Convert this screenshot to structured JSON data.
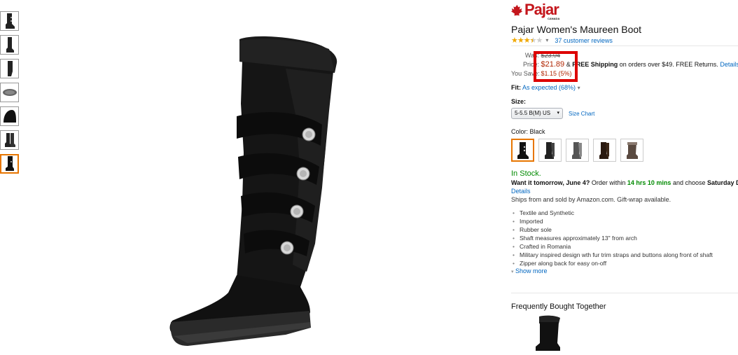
{
  "brand": {
    "name": "Pajar",
    "sub": "CANADA"
  },
  "product": {
    "title": "Pajar Women's Maureen Boot",
    "rating_stars": 3.5,
    "reviews_label": "37 customer reviews"
  },
  "pricing": {
    "was_label": "Was:",
    "was_value": "$23.04",
    "price_label": "Price:",
    "price_value": "$21.89",
    "shipping_amp": "&",
    "shipping_free": "FREE Shipping",
    "shipping_rest": "on orders over $49. FREE Returns.",
    "details_link": "Details",
    "save_label": "You Save:",
    "save_value": "$1.15 (5%)"
  },
  "fit": {
    "label": "Fit:",
    "value": "As expected (68%)"
  },
  "size": {
    "label": "Size:",
    "selected": "5-5.5 B(M) US",
    "chart_link": "Size Chart"
  },
  "color": {
    "label": "Color:",
    "value": "Black"
  },
  "availability": {
    "status": "In Stock.",
    "want_prefix": "Want it tomorrow, June 4?",
    "want_mid": "Order within",
    "want_time": "14 hrs 10 mins",
    "want_mid2": "and choose",
    "want_option": "Saturday Delivery",
    "details_link": "Details",
    "ships_from": "Ships from and sold by Amazon.com. Gift-wrap available."
  },
  "features": [
    "Textile and Synthetic",
    "Imported",
    "Rubber sole",
    "Shaft measures approximately 13\" from arch",
    "Crafted in Romania",
    "Military inspired design wth fur trim straps and buttons along front of shaft",
    "Zipper along back for easy on-off"
  ],
  "show_more": "Show more",
  "fbt": {
    "title": "Frequently Bought Together"
  },
  "colors": {
    "accent": "#e77600",
    "price": "#b12704",
    "link": "#0066c0",
    "stock": "#008a00",
    "highlight_box": "#dd0000",
    "brand": "#c4161c"
  }
}
